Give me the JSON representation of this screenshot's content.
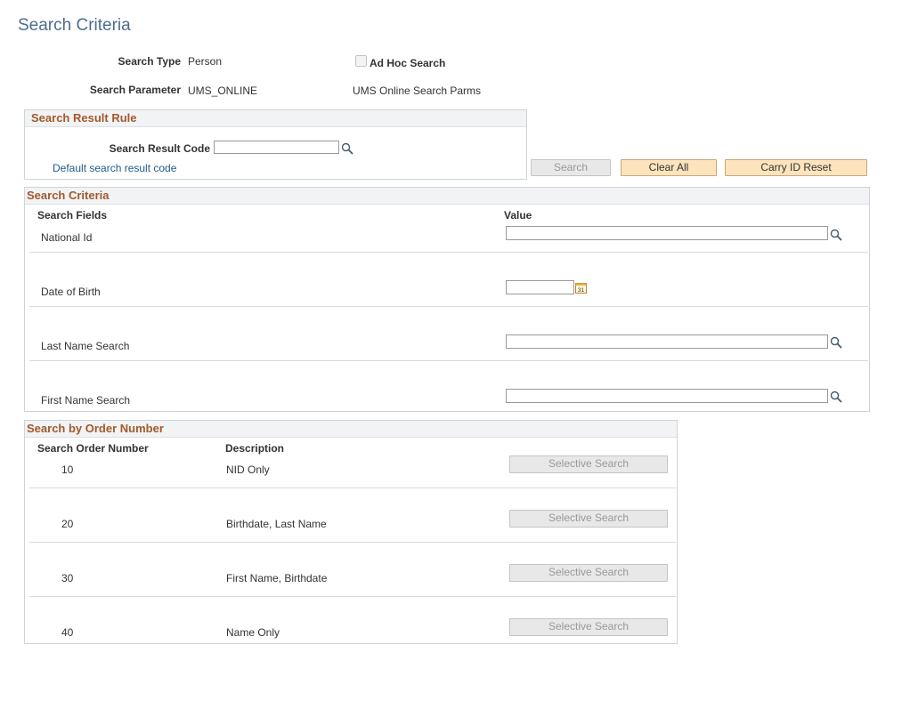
{
  "page": {
    "title": "Search Criteria"
  },
  "top": {
    "search_type_label": "Search Type",
    "search_type_value": "Person",
    "ad_hoc_label": "Ad Hoc Search",
    "search_param_label": "Search Parameter",
    "search_param_value": "UMS_ONLINE",
    "search_param_desc": "UMS Online Search Parms"
  },
  "result_rule": {
    "header": "Search Result Rule",
    "code_label": "Search Result Code",
    "code_value": "",
    "default_link": "Default search result code"
  },
  "buttons": {
    "search": "Search",
    "clear_all": "Clear All",
    "carry_id_reset": "Carry ID Reset"
  },
  "criteria": {
    "header": "Search Criteria",
    "col_fields": "Search Fields",
    "col_value": "Value",
    "rows": [
      {
        "label": "National Id",
        "value": ""
      },
      {
        "label": "Date of Birth",
        "value": ""
      },
      {
        "label": "Last Name Search",
        "value": ""
      },
      {
        "label": "First Name Search",
        "value": ""
      }
    ]
  },
  "order": {
    "header": "Search by Order Number",
    "col_number": "Search Order Number",
    "col_desc": "Description",
    "rows": [
      {
        "number": "10",
        "desc": "NID Only",
        "button": "Selective Search"
      },
      {
        "number": "20",
        "desc": "Birthdate, Last Name",
        "button": "Selective Search"
      },
      {
        "number": "30",
        "desc": "First Name, Birthdate",
        "button": "Selective Search"
      },
      {
        "number": "40",
        "desc": "Name Only",
        "button": "Selective Search"
      }
    ]
  },
  "icons": {
    "lookup": "magnifier-icon",
    "calendar": "calendar-icon"
  },
  "colors": {
    "title": "#4d6c8f",
    "group_header": "#a3592a",
    "link": "#1f5a8c",
    "active_button": "#fde4bd"
  }
}
